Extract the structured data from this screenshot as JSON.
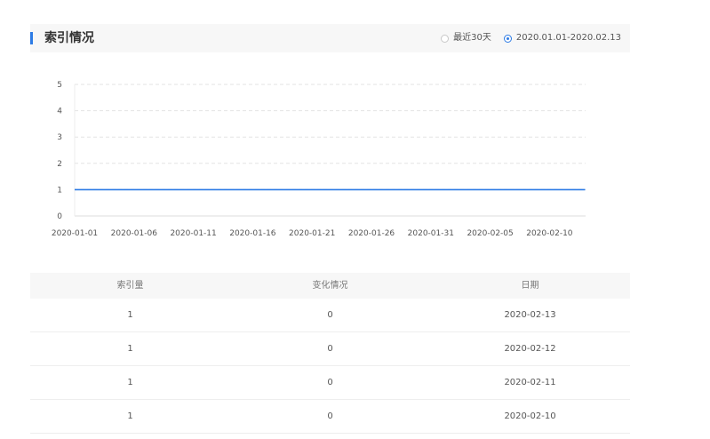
{
  "header": {
    "title": "索引情况",
    "accent_color": "#2d7be5",
    "options": [
      {
        "label": "最近30天",
        "selected": false
      },
      {
        "label": "2020.01.01-2020.02.13",
        "selected": true
      }
    ]
  },
  "chart_data": {
    "type": "line",
    "x": [
      "2020-01-01",
      "2020-01-06",
      "2020-01-11",
      "2020-01-16",
      "2020-01-21",
      "2020-01-26",
      "2020-01-31",
      "2020-02-05",
      "2020-02-10",
      "2020-02-13"
    ],
    "x_ticks": [
      "2020-01-01",
      "2020-01-06",
      "2020-01-11",
      "2020-01-16",
      "2020-01-21",
      "2020-01-26",
      "2020-01-31",
      "2020-02-05",
      "2020-02-10"
    ],
    "series": [
      {
        "values": [
          1,
          1,
          1,
          1,
          1,
          1,
          1,
          1,
          1,
          1
        ],
        "color": "#2d7be5"
      }
    ],
    "ylim": [
      0,
      5
    ],
    "y_ticks": [
      0,
      1,
      2,
      3,
      4,
      5
    ],
    "grid": true
  },
  "table": {
    "headers": [
      "索引量",
      "变化情况",
      "日期"
    ],
    "rows": [
      [
        "1",
        "0",
        "2020-02-13"
      ],
      [
        "1",
        "0",
        "2020-02-12"
      ],
      [
        "1",
        "0",
        "2020-02-11"
      ],
      [
        "1",
        "0",
        "2020-02-10"
      ]
    ]
  }
}
